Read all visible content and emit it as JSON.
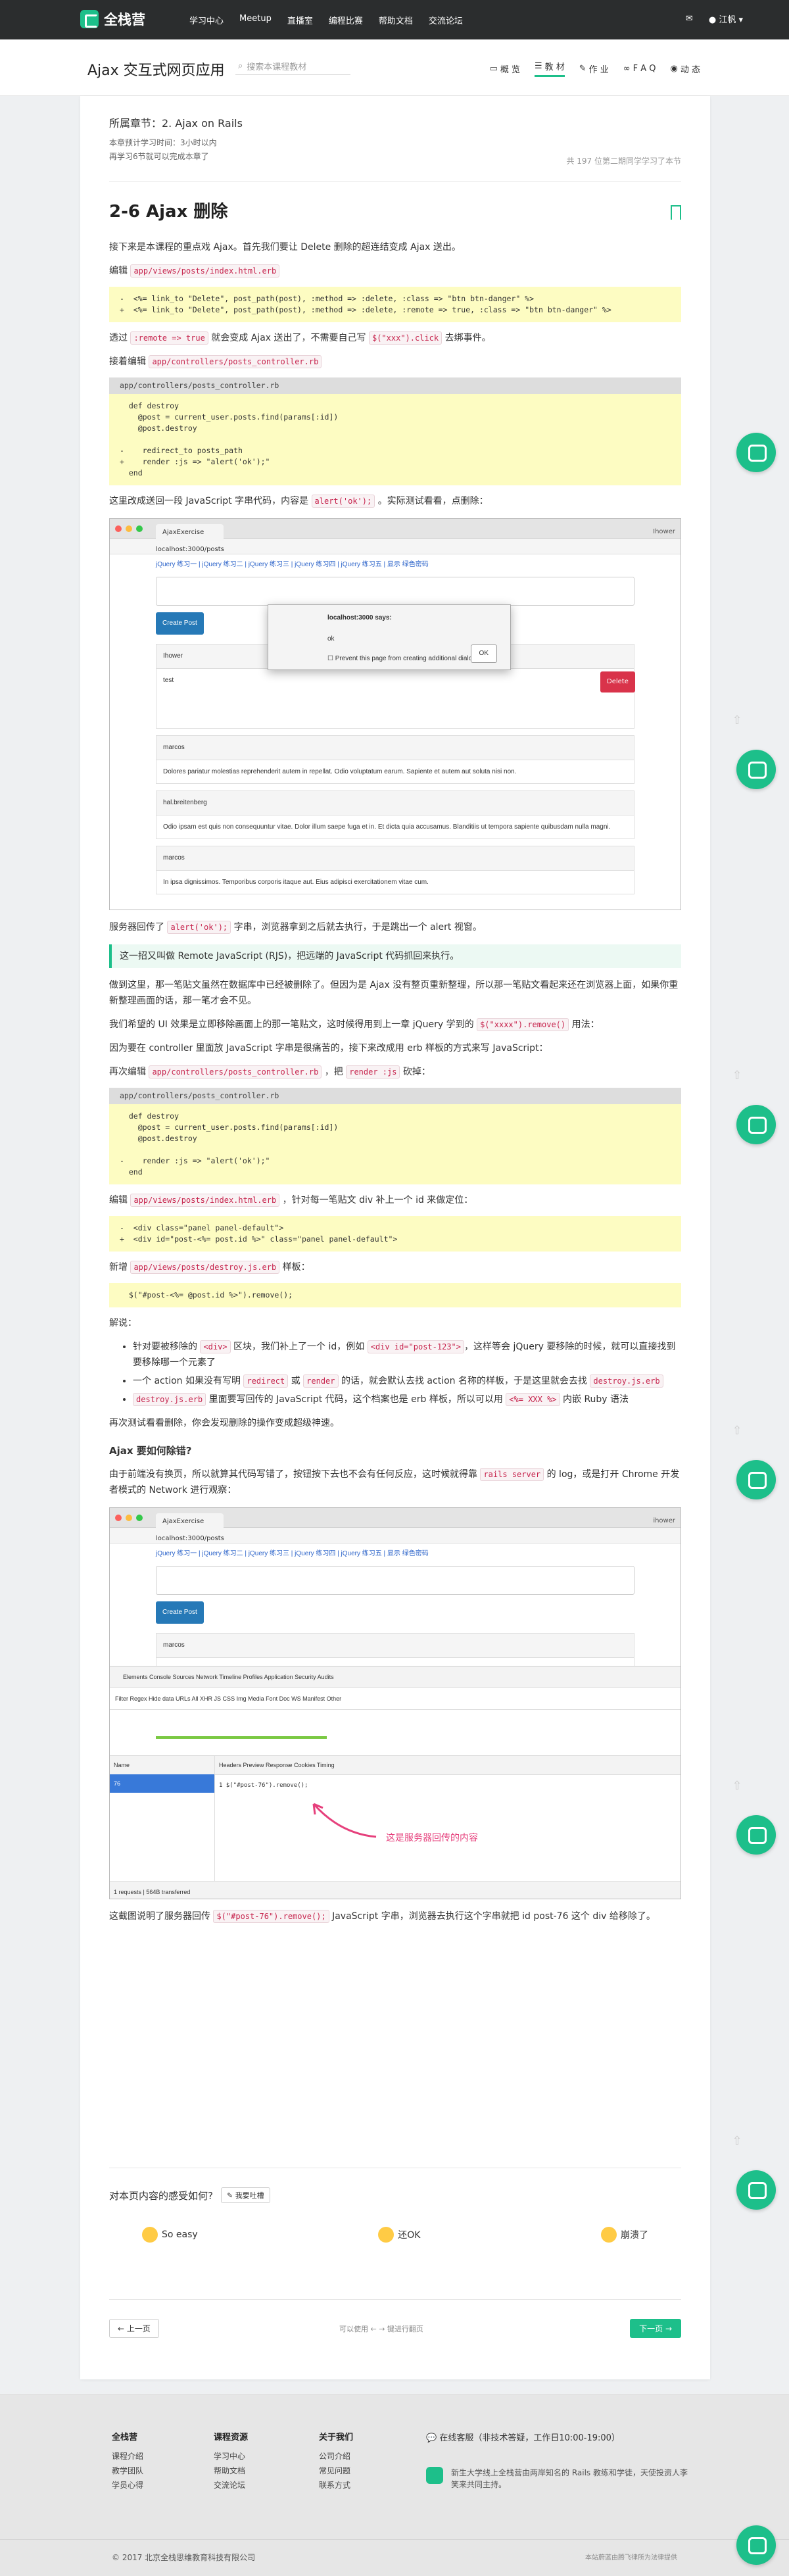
{
  "nav": {
    "brand": "全栈营",
    "links": [
      "学习中心",
      "Meetup",
      "直播室",
      "编程比赛",
      "帮助文档",
      "交流论坛"
    ],
    "user": "江帆"
  },
  "sub": {
    "course_title": "Ajax 交互式网页应用",
    "search_placeholder": "搜索本课程教材",
    "tabs": [
      "概 览",
      "教 材",
      "作 业",
      "F A Q",
      "动 态"
    ]
  },
  "chapter": {
    "line1": "所属章节：2. Ajax on Rails",
    "line2": "本章预计学习时间：3小时以内",
    "line3": "再学习6节就可以完成本章了",
    "progress": "共 197 位第二期同学学习了本节"
  },
  "lesson": {
    "title": "2-6 Ajax 删除",
    "p1": "接下来是本课程的重点戏 Ajax。首先我们要让 Delete 删除的超连结变成 Ajax 送出。",
    "edit1_pre": "编辑",
    "file1": "app/views/posts/index.html.erb",
    "diff1": "-  <%= link_to \"Delete\", post_path(post), :method => :delete, :class => \"btn btn-danger\" %>\n+  <%= link_to \"Delete\", post_path(post), :method => :delete, :remote => true, :class => \"btn btn-danger\" %>",
    "p2_a": "透过",
    "p2_code1": ":remote => true",
    "p2_b": "就会变成 Ajax 送出了，不需要自己写",
    "p2_code2": "$(\"xxx\").click",
    "p2_c": "去绑事件。",
    "edit2_pre": "接着编辑",
    "file2": "app/controllers/posts_controller.rb",
    "code2_file": "app/controllers/posts_controller.rb",
    "code2": "  def destroy\n    @post = current_user.posts.find(params[:id])\n    @post.destroy\n\n-    redirect_to posts_path\n+    render :js => \"alert('ok');\"\n  end",
    "p3_a": "这里改成送回一段 JavaScript 字串代码，内容是",
    "p3_code": "alert('ok');",
    "p3_b": "。实际测试看看，点删除：",
    "shot1": {
      "tab": "AjaxExercise",
      "user": "Ihower",
      "url": "localhost:3000/posts",
      "links": "jQuery 练习一 | jQuery 练习二 | jQuery 练习三 | jQuery 练习四 | jQuery 练习五 | 显示 绿色密码",
      "create": "Create Post",
      "post1_user": "Ihower",
      "post1_body": "test",
      "delete": "Delete",
      "dialog_title": "localhost:3000 says:",
      "dialog_msg": "ok",
      "dialog_check": "Prevent this page from creating additional dialogs.",
      "dialog_ok": "OK",
      "post2_user": "marcos",
      "post2_body": "Dolores pariatur molestias reprehenderit autem in repellat. Odio voluptatum earum. Sapiente et autem aut soluta nisi non.",
      "post3_user": "hal.breitenberg",
      "post3_body": "Odio ipsam est quis non consequuntur vitae. Dolor illum saepe fuga et in. Et dicta quia accusamus. Blanditiis ut tempora sapiente quibusdam nulla magni.",
      "post4_user": "marcos",
      "post4_body": "In ipsa dignissimos. Temporibus corporis itaque aut. Eius adipisci exercitationem vitae cum."
    },
    "p4_a": "服务器回传了",
    "p4_code": "alert('ok');",
    "p4_b": "字串，浏览器拿到之后就去执行，于是跳出一个 alert 视窗。",
    "notice": "这一招又叫做 Remote JavaScript (RJS)，把远端的 JavaScript 代码抓回来执行。",
    "p5": "做到这里，那一笔贴文虽然在数据库中已经被删除了。但因为是 Ajax 没有整页重新整理，所以那一笔贴文看起来还在浏览器上面，如果你重新整理画面的话，那一笔才会不见。",
    "p6_a": "我们希望的 UI 效果是立即移除画面上的那一笔贴文，这时候得用到上一章 jQuery 学到的",
    "p6_code": "$(\"xxxx\").remove()",
    "p6_b": "用法：",
    "p7": "因为要在 controller 里面放 JavaScript 字串是很痛苦的，接下来改成用 erb 样板的方式来写 JavaScript：",
    "p8_a": "再次编辑",
    "p8_file": "app/controllers/posts_controller.rb",
    "p8_b": "，把",
    "p8_code": "render :js",
    "p8_c": "砍掉：",
    "code3_file": "app/controllers/posts_controller.rb",
    "code3": "  def destroy\n    @post = current_user.posts.find(params[:id])\n    @post.destroy\n\n-    render :js => \"alert('ok');\"\n  end",
    "p9_a": "编辑",
    "p9_file": "app/views/posts/index.html.erb",
    "p9_b": "，针对每一笔贴文 div 补上一个 id 来做定位：",
    "diff4": "-  <div class=\"panel panel-default\">\n+  <div id=\"post-<%= post.id %>\" class=\"panel panel-default\">",
    "p10_a": "新增",
    "p10_file": "app/views/posts/destroy.js.erb",
    "p10_b": "样板：",
    "code5": "  $(\"#post-<%= @post.id %>\").remove();",
    "explain": "解说：",
    "b1_a": "针对要被移除的",
    "b1_c1": "<div>",
    "b1_b": "区块，我们补上了一个 id，例如",
    "b1_c2": "<div id=\"post-123\">",
    "b1_c": "，这样等会 jQuery 要移除的时候，就可以直接找到要移除哪一个元素了",
    "b2_a": "一个 action 如果没有写明",
    "b2_c1": "redirect",
    "b2_b": "或",
    "b2_c2": "render",
    "b2_c": "的话，就会默认去找 action 名称的样板，于是这里就会去找",
    "b2_c3": "destroy.js.erb",
    "b3_c1": "destroy.js.erb",
    "b3_a": "里面要写回传的 JavaScript 代码，这个档案也是 erb 样板，所以可以用",
    "b3_c2": "<%= XXX %>",
    "b3_b": "内嵌 Ruby 语法",
    "p11": "再次测试看看删除，你会发现删除的操作变成超级神速。",
    "h_ajax": "Ajax 要如何除错?",
    "p12_a": "由于前端没有换页，所以就算其代码写错了，按钮按下去也不会有任何反应，这时候就得靠",
    "p12_code": "rails server",
    "p12_b": "的 log，或是打开 Chrome 开发者模式的 Network 进行观察：",
    "shot2": {
      "tab": "AjaxExercise",
      "user": "ihower",
      "url": "localhost:3000/posts",
      "links": "jQuery 练习一 | jQuery 练习二 | jQuery 练习三 | jQuery 练习四 | jQuery 练习五 | 显示 绿色密码",
      "create": "Create Post",
      "post_user": "marcos",
      "post_body": "Dolores pariatur molestias reprehenderit autem in repellat. Odio voluptatum earum. Sapiente et autem aut soluta nisi non.",
      "dev_tabs": "Elements   Console   Sources   Network   Timeline   Profiles   Application   Security   Audits",
      "dev_filter": "Filter   Regex   Hide data URLs   All   XHR   JS   CSS   Img   Media   Font   Doc   WS   Manifest   Other",
      "name_col": "Name",
      "req": "76",
      "resp_tabs": "Headers   Preview   Response   Cookies   Timing",
      "resp": "1  $(\"#post-76\").remove();",
      "footer": "1 requests | 564B transferred",
      "annotation": "这是服务器回传的内容"
    },
    "p13_a": "这截图说明了服务器回传",
    "p13_code": "$(\"#post-76\").remove();",
    "p13_b": "JavaScript 字串，浏览器去执行这个字串就把 id post-76 这个 div 给移除了。"
  },
  "feedback": {
    "question": "对本页内容的感受如何?",
    "btn": "我要吐槽",
    "opt1": "So easy",
    "opt2": "还OK",
    "opt3": "崩溃了"
  },
  "pager": {
    "prev": "上一页",
    "help": "可以使用 ← → 键进行翻页",
    "next": "下一页"
  },
  "footer": {
    "col1_title": "全栈营",
    "col1": [
      "课程介绍",
      "教学团队",
      "学员心得"
    ],
    "col2_title": "课程资源",
    "col2": [
      "学习中心",
      "帮助文档",
      "交流论坛"
    ],
    "col3_title": "关于我们",
    "col3": [
      "公司介绍",
      "常见问题",
      "联系方式"
    ],
    "support": "在线客服（非技术答疑，工作日10:00-19:00）",
    "about": "新生大学线上全栈营由两岸知名的 Rails 教练和学徒，天使投资人李笑来共同主持。",
    "copy": "© 2017 北京全栈思维教育科技有限公司",
    "icp": "本站蔚蓝由腾飞律所为法律提供"
  }
}
